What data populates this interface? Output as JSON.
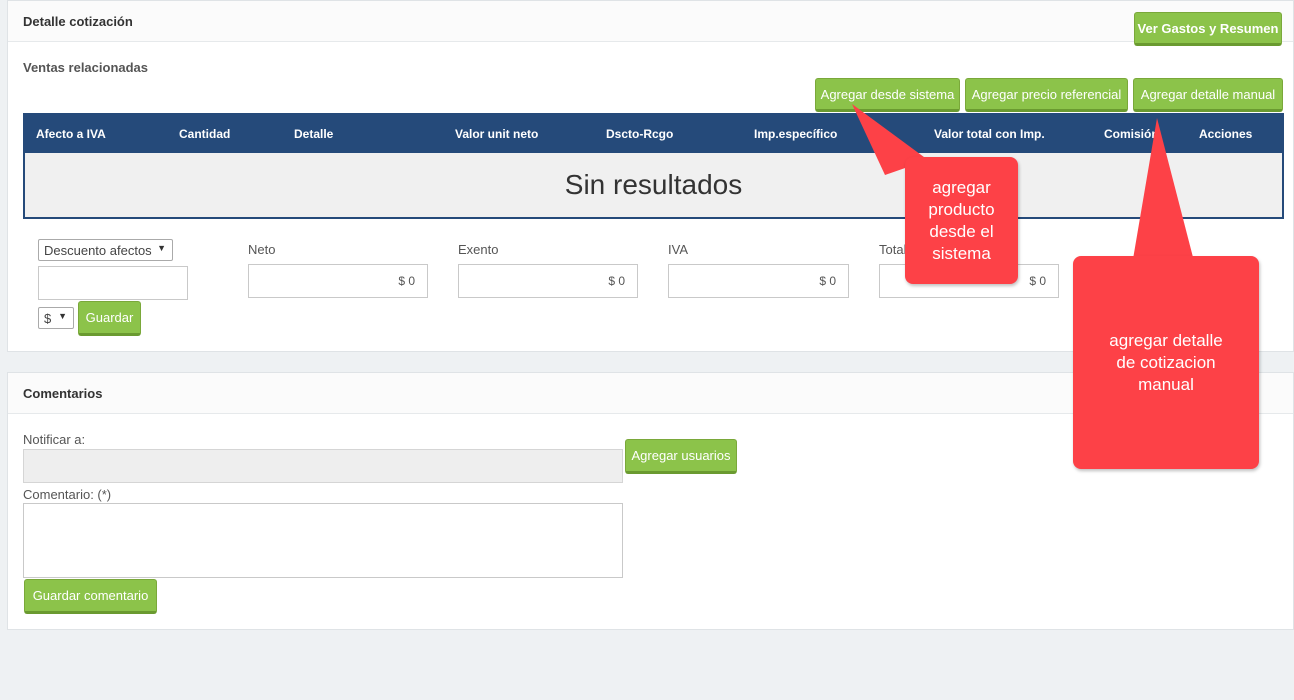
{
  "detail_panel": {
    "title": "Detalle cotización",
    "summary_button": "Ver Gastos y Resumen",
    "section_label": "Ventas relacionadas",
    "buttons": {
      "from_system": "Agregar desde sistema",
      "reference_price": "Agregar precio referencial",
      "manual_detail": "Agregar detalle manual"
    },
    "table": {
      "columns": [
        "Afecto a IVA",
        "Cantidad",
        "Detalle",
        "Valor unit neto",
        "Dscto-Rcgo",
        "Imp.específico",
        "Valor total con Imp.",
        "Comisión",
        "Acciones"
      ],
      "empty_text": "Sin resultados"
    },
    "discount": {
      "select_value": "Descuento afectos",
      "input_value": "",
      "currency_value": "$",
      "save_button": "Guardar"
    },
    "totals": {
      "neto_label": "Neto",
      "neto_value": "$ 0",
      "exento_label": "Exento",
      "exento_value": "$ 0",
      "iva_label": "IVA",
      "iva_value": "$ 0",
      "total_label": "Total",
      "total_value": "$ 0"
    }
  },
  "comments_panel": {
    "title": "Comentarios",
    "notify_label": "Notificar a:",
    "notify_value": "",
    "add_users_button": "Agregar usuarios",
    "comment_label": "Comentario: (*)",
    "comment_value": "",
    "save_comment_button": "Guardar comentario"
  },
  "annotations": {
    "callout_system": "agregar producto desde el sistema",
    "callout_manual": "agregar detalle de cotizacion manual",
    "color": "#fd4147"
  },
  "colors": {
    "accent_green": "#8cc34a",
    "table_header": "#254a7a",
    "background": "#eef1f3"
  }
}
